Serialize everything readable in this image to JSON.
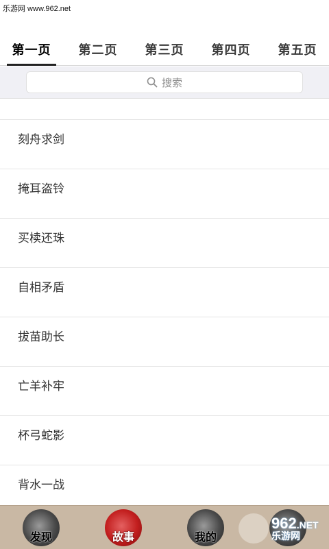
{
  "watermark": "乐游网 www.962.net",
  "tabs": [
    {
      "label": "第一页",
      "active": true
    },
    {
      "label": "第二页",
      "active": false
    },
    {
      "label": "第三页",
      "active": false
    },
    {
      "label": "第四页",
      "active": false
    },
    {
      "label": "第五页",
      "active": false
    }
  ],
  "search": {
    "placeholder": "搜索",
    "icon": "search-icon"
  },
  "idioms": [
    "刻舟求剑",
    "掩耳盗铃",
    "买椟还珠",
    "自相矛盾",
    "拔苗助长",
    "亡羊补牢",
    "杯弓蛇影",
    "背水一战"
  ],
  "bottom_nav": [
    {
      "label": "发现",
      "icon": "ink-circle-icon"
    },
    {
      "label": "故事",
      "icon": "red-ink-circle-icon"
    },
    {
      "label": "我的",
      "icon": "fan-ink-circle-icon"
    },
    {
      "label": "",
      "icon": "ink-circle-icon"
    }
  ],
  "overlay_logo": {
    "big": "962",
    "net": ".NET",
    "small": "乐游网"
  },
  "colors": {
    "bottom_bar": "#c9b8a4",
    "search_bg": "#f0f0f5",
    "active_underline": "#222222"
  }
}
